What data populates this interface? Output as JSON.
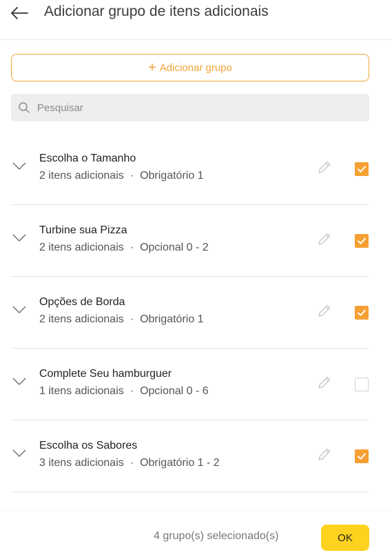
{
  "header": {
    "title": "Adicionar grupo de itens adicionais"
  },
  "add_group": {
    "label": "Adicionar grupo"
  },
  "search": {
    "placeholder": "Pesquisar",
    "value": ""
  },
  "groups": [
    {
      "title": "Escolha o Tamanho",
      "items": "2 itens adicionais",
      "separator": "·",
      "rule": "Obrigatório 1",
      "checked": true
    },
    {
      "title": "Turbine sua Pizza",
      "items": "2 itens adicionais",
      "separator": "·",
      "rule": "Opcional 0 - 2",
      "checked": true
    },
    {
      "title": "Opções de Borda",
      "items": "2 itens adicionais",
      "separator": "·",
      "rule": "Obrigatório 1",
      "checked": true
    },
    {
      "title": "Complete Seu hamburguer",
      "items": "1 itens adicionais",
      "separator": "·",
      "rule": "Opcional 0 - 6",
      "checked": false
    },
    {
      "title": "Escolha os Sabores",
      "items": "3 itens adicionais",
      "separator": "·",
      "rule": "Obrigatório 1 - 2",
      "checked": true
    }
  ],
  "footer": {
    "count_label": "4 grupo(s) selecionado(s)",
    "ok_label": "OK"
  },
  "colors": {
    "accent": "#f6a033",
    "ok_button": "#ffd21f"
  },
  "icons": {
    "back": "arrow-left-icon",
    "add": "plus-icon",
    "search": "search-icon",
    "expand": "chevron-down-icon",
    "edit": "pencil-icon",
    "check": "check-icon"
  }
}
